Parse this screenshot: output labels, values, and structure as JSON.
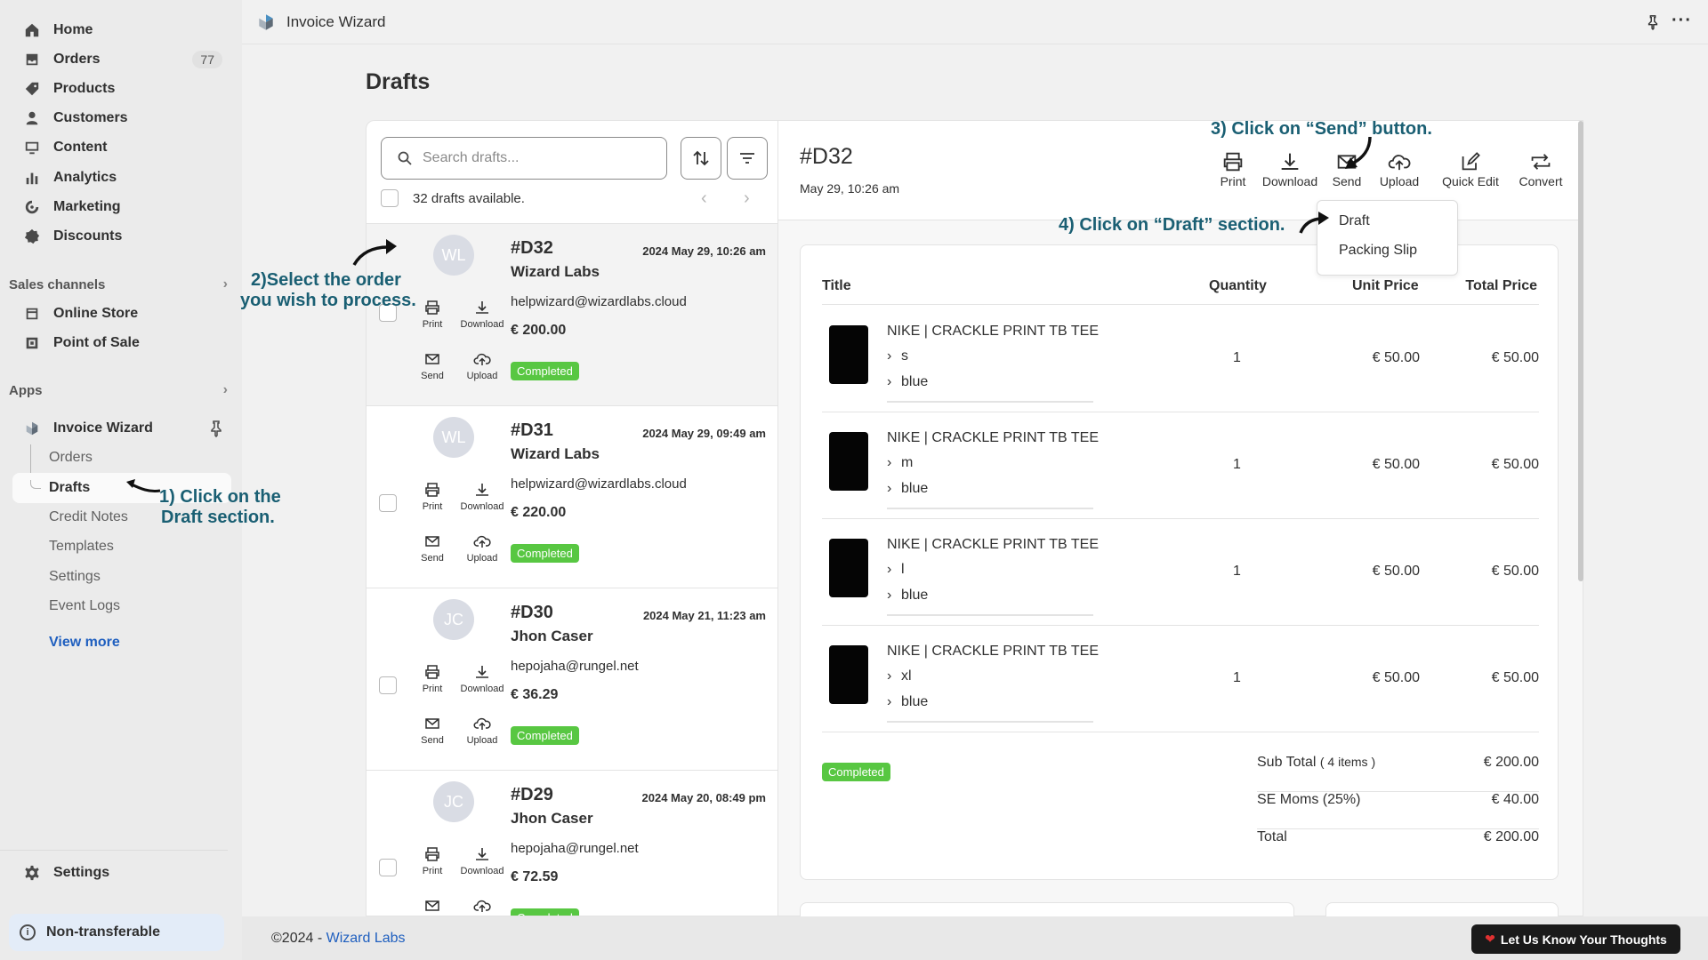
{
  "app": {
    "title": "Invoice Wizard"
  },
  "sidebar": {
    "items": [
      {
        "label": "Home",
        "icon": "home-icon"
      },
      {
        "label": "Orders",
        "icon": "orders-icon",
        "badge": "77"
      },
      {
        "label": "Products",
        "icon": "tag-icon"
      },
      {
        "label": "Customers",
        "icon": "person-icon"
      },
      {
        "label": "Content",
        "icon": "content-icon"
      },
      {
        "label": "Analytics",
        "icon": "bar-chart-icon"
      },
      {
        "label": "Marketing",
        "icon": "target-icon"
      },
      {
        "label": "Discounts",
        "icon": "discount-icon"
      }
    ],
    "sales_channels_heading": "Sales channels",
    "channels": [
      {
        "label": "Online Store",
        "icon": "store-icon"
      },
      {
        "label": "Point of Sale",
        "icon": "pos-icon"
      }
    ],
    "apps_heading": "Apps",
    "app_name": "Invoice Wizard",
    "app_subitems": [
      "Orders",
      "Drafts",
      "Credit Notes",
      "Templates",
      "Settings",
      "Event Logs"
    ],
    "view_more": "View more",
    "settings": "Settings",
    "non_transferable": "Non-transferable"
  },
  "page": {
    "title": "Drafts"
  },
  "list": {
    "search_placeholder": "Search drafts...",
    "available": "32 drafts available.",
    "actions": {
      "print": "Print",
      "download": "Download",
      "send": "Send",
      "upload": "Upload"
    },
    "drafts": [
      {
        "initials": "WL",
        "id": "#D32",
        "date": "2024 May 29, 10:26 am",
        "customer": "Wizard Labs",
        "email": "helpwizard@wizardlabs.cloud",
        "total": "€ 200.00",
        "status": "Completed"
      },
      {
        "initials": "WL",
        "id": "#D31",
        "date": "2024 May 29, 09:49 am",
        "customer": "Wizard Labs",
        "email": "helpwizard@wizardlabs.cloud",
        "total": "€ 220.00",
        "status": "Completed"
      },
      {
        "initials": "JC",
        "id": "#D30",
        "date": "2024 May 21, 11:23 am",
        "customer": "Jhon Caser",
        "email": "hepojaha@rungel.net",
        "total": "€ 36.29",
        "status": "Completed"
      },
      {
        "initials": "JC",
        "id": "#D29",
        "date": "2024 May 20, 08:49 pm",
        "customer": "Jhon Caser",
        "email": "hepojaha@rungel.net",
        "total": "€ 72.59",
        "status": "Completed"
      }
    ]
  },
  "detail": {
    "id": "#D32",
    "date": "May 29, 10:26 am",
    "toolbar": {
      "print": "Print",
      "download": "Download",
      "send": "Send",
      "upload": "Upload",
      "quick_edit": "Quick Edit",
      "convert": "Convert"
    },
    "send_menu": [
      "Draft",
      "Packing Slip"
    ],
    "table_headers": {
      "title": "Title",
      "quantity": "Quantity",
      "unit_price": "Unit Price",
      "total_price": "Total Price"
    },
    "lines": [
      {
        "name": "NIKE | CRACKLE PRINT TB TEE",
        "size": "s",
        "color": "blue",
        "qty": "1",
        "unit": "€ 50.00",
        "total": "€ 50.00"
      },
      {
        "name": "NIKE | CRACKLE PRINT TB TEE",
        "size": "m",
        "color": "blue",
        "qty": "1",
        "unit": "€ 50.00",
        "total": "€ 50.00"
      },
      {
        "name": "NIKE | CRACKLE PRINT TB TEE",
        "size": "l",
        "color": "blue",
        "qty": "1",
        "unit": "€ 50.00",
        "total": "€ 50.00"
      },
      {
        "name": "NIKE | CRACKLE PRINT TB TEE",
        "size": "xl",
        "color": "blue",
        "qty": "1",
        "unit": "€ 50.00",
        "total": "€ 50.00"
      }
    ],
    "status": "Completed",
    "summary": {
      "subtotal_label": "Sub Total",
      "subtotal_items": "( 4 items )",
      "subtotal": "€ 200.00",
      "tax_label": "SE Moms (25%)",
      "tax": "€ 40.00",
      "total_label": "Total",
      "total": "€ 200.00"
    }
  },
  "footer": {
    "copyright": "©2024 - ",
    "company": "Wizard Labs",
    "feedback": "Let Us Know Your Thoughts"
  },
  "annotations": {
    "step1_line1": "1) Click on the",
    "step1_line2": "Draft section.",
    "step2_line1": "2)Select the order",
    "step2_line2": "you wish to process.",
    "step3": "3) Click on “Send” button.",
    "step4": "4) Click on “Draft” section."
  },
  "colors": {
    "accent_link": "#1f5fbf",
    "status_green": "#58c742",
    "annotation": "#1a5f73"
  }
}
